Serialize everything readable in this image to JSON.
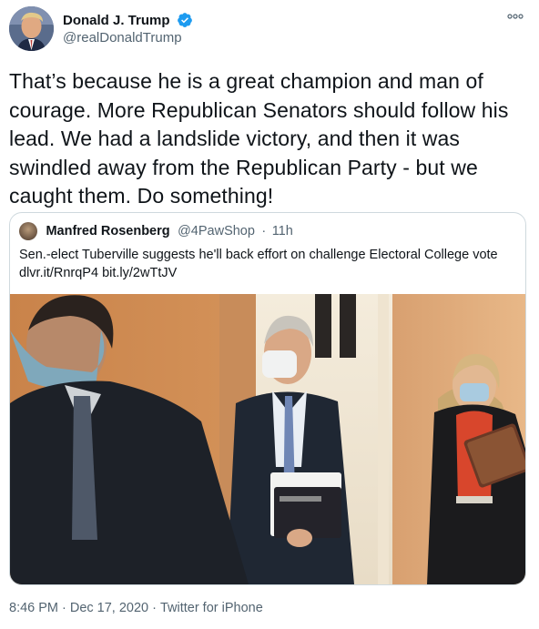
{
  "author": {
    "display_name": "Donald J. Trump",
    "handle": "@realDonaldTrump",
    "verified": true
  },
  "tweet": {
    "lines": [
      "That’s because he is a great champion and man of",
      "courage. More Republican Senators should follow his",
      "lead. We had a landslide victory, and then it was",
      "swindled away from the Republican Party - but we",
      "caught them. Do something!"
    ]
  },
  "quoted": {
    "display_name": "Manfred Rosenberg",
    "handle": "@4PawShop",
    "separator": "·",
    "time": "11h",
    "text_line": "Sen.-elect Tuberville suggests he'll back effort on challenge Electoral College vote",
    "link1": "dlvr.it/RnrqP4",
    "link2": "bit.ly/2wTtJV"
  },
  "footer": {
    "time": "8:46 PM",
    "date": "Dec 17, 2020",
    "source": "Twitter for iPhone",
    "separator": "·"
  },
  "colors": {
    "accent": "#1d9bf0",
    "muted": "#536471",
    "text": "#0f1419",
    "border": "#cfd9de"
  },
  "icons": {
    "verified": "verified-badge-icon",
    "more": "more-options-icon"
  }
}
